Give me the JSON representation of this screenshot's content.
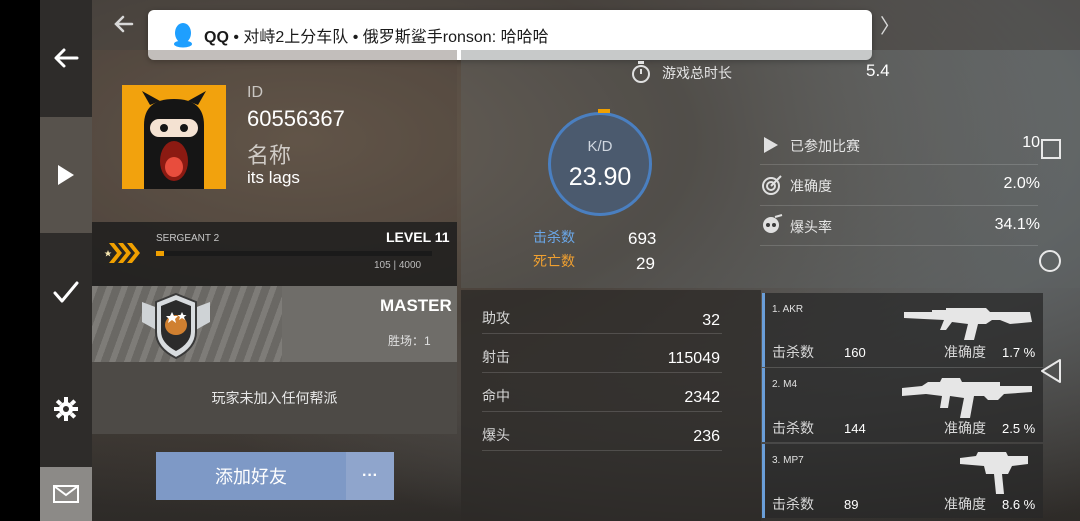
{
  "notification": {
    "app": "QQ",
    "separator": " • ",
    "text": "对峙2上分车队 • 俄罗斯鲨手ronson: 哈哈哈"
  },
  "profile": {
    "id_label": "ID",
    "id_value": "60556367",
    "name_label": "名称",
    "name_value": "its lags"
  },
  "level": {
    "rank_title": "SERGEANT 2",
    "level_text": "LEVEL 11",
    "xp_current": 105,
    "xp_max": 4000,
    "xp_text": "105 | 4000"
  },
  "rank": {
    "title": "MASTER",
    "wins_text": "胜场：1"
  },
  "clan": {
    "text": "玩家未加入任何帮派"
  },
  "actions": {
    "add_friend": "添加好友",
    "more": "···"
  },
  "stats": {
    "playtime_label": "游戏总时长",
    "playtime_value": "5.4",
    "kd_label": "K/D",
    "kd_value": "23.90",
    "kills_label": "击杀数",
    "kills_value": "693",
    "deaths_label": "死亡数",
    "deaths_value": "29",
    "matches_label": "已参加比赛",
    "matches_value": "10",
    "accuracy_label": "准确度",
    "accuracy_value": "2.0%",
    "headshot_rate_label": "爆头率",
    "headshot_rate_value": "34.1%"
  },
  "details": [
    {
      "label": "助攻",
      "value": "32"
    },
    {
      "label": "射击",
      "value": "115049"
    },
    {
      "label": "命中",
      "value": "2342"
    },
    {
      "label": "爆头",
      "value": "236"
    }
  ],
  "weapons": [
    {
      "name": "1. AKR",
      "kills_label": "击杀数",
      "kills": "160",
      "acc_label": "准确度",
      "acc": "1.7 %"
    },
    {
      "name": "2. M4",
      "kills_label": "击杀数",
      "kills": "144",
      "acc_label": "准确度",
      "acc": "2.5 %"
    },
    {
      "name": "3. MP7",
      "kills_label": "击杀数",
      "kills": "89",
      "acc_label": "准确度",
      "acc": "8.6 %"
    }
  ],
  "colors": {
    "accent_orange": "#f0a000",
    "accent_blue": "#4a7fc0",
    "add_friend_bg": "#7e99c6"
  }
}
